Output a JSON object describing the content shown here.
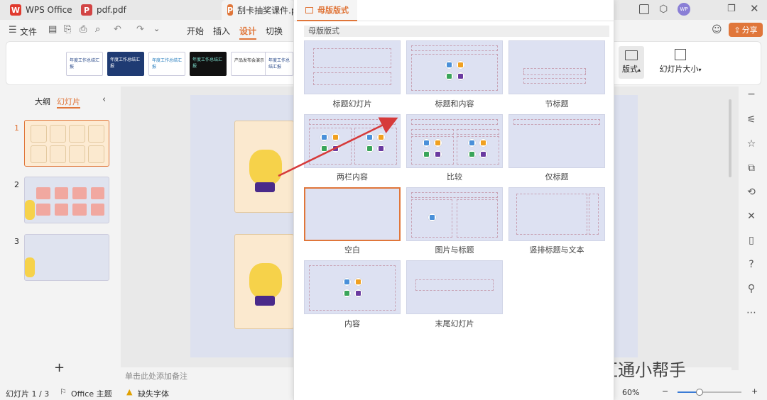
{
  "tabs": [
    {
      "label": "WPS Office",
      "icon": "wps-icon"
    },
    {
      "label": "pdf.pdf",
      "icon": "pdf-icon"
    },
    {
      "label": "刮卡抽奖课件.pp",
      "icon": "ppt-icon"
    }
  ],
  "titlebar": {
    "avatar": "WP"
  },
  "menu": {
    "file": "文件",
    "items": [
      "开始",
      "插入",
      "设计",
      "切换"
    ],
    "active": "设计",
    "share": "分享"
  },
  "ribbon": {
    "thumbs": [
      "年度工作总结汇报",
      "年度工作总结汇报",
      "年度工作总结汇报",
      "年度工作总结汇报",
      "年度工作总结汇报",
      "产品发布会演示",
      "年度工作总结汇报"
    ],
    "layout_label": "版式",
    "size_label": "幻灯片大小"
  },
  "left_panel": {
    "tab_outline": "大纲",
    "tab_slides": "幻灯片",
    "slide_numbers": [
      "1",
      "2",
      "3"
    ],
    "add": "+"
  },
  "notes_placeholder": "单击此处添加备注",
  "status": {
    "slide_count": "幻灯片 1 / 3",
    "theme": "Office 主题",
    "missing_font": "缺失字体",
    "zoom": "60%"
  },
  "popup": {
    "tab_title": "母版版式",
    "section_title": "母版版式",
    "layouts": [
      {
        "label": "标题幻灯片"
      },
      {
        "label": "标题和内容"
      },
      {
        "label": "节标题"
      },
      {
        "label": "两栏内容"
      },
      {
        "label": "比较"
      },
      {
        "label": "仅标题"
      },
      {
        "label": "空白"
      },
      {
        "label": "图片与标题"
      },
      {
        "label": "竖排标题与文本"
      },
      {
        "label": "内容"
      },
      {
        "label": "末尾幻灯片"
      }
    ],
    "selected": "空白"
  },
  "watermark": {
    "text": "公众号 · 互通小帮手"
  },
  "colors": {
    "accent": "#e0763a",
    "placeholder_bg": "#dde1f2",
    "slide_bg": "#dde1ef"
  }
}
